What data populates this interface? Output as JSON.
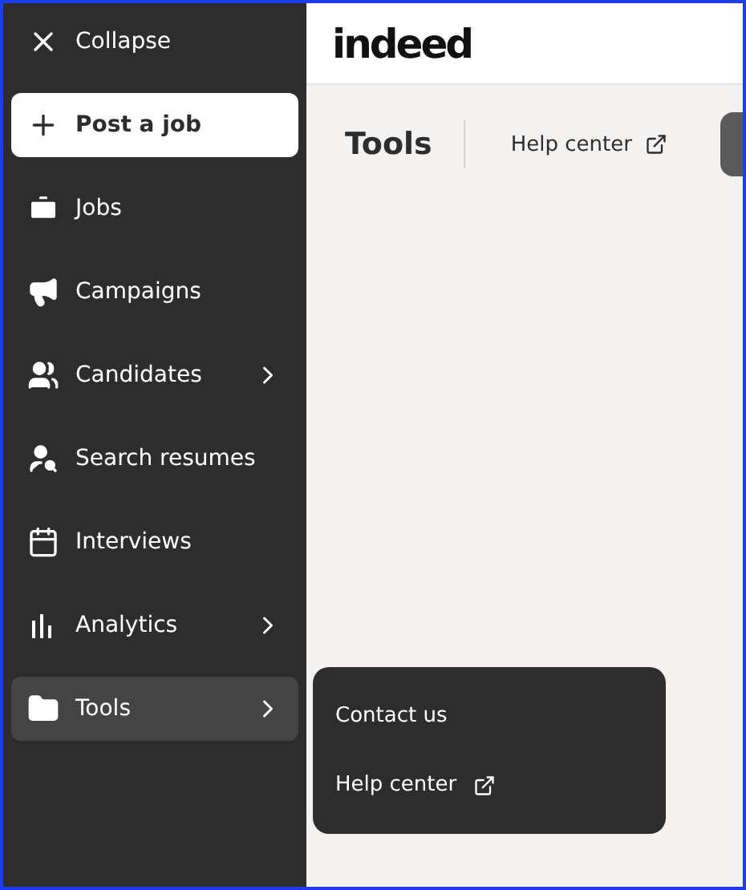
{
  "sidebar": {
    "collapse": {
      "label": "Collapse"
    },
    "post_job": {
      "label": "Post a job"
    },
    "items": [
      {
        "label": "Jobs",
        "has_submenu": false,
        "selected": false
      },
      {
        "label": "Campaigns",
        "has_submenu": false,
        "selected": false
      },
      {
        "label": "Candidates",
        "has_submenu": true,
        "selected": false
      },
      {
        "label": "Search resumes",
        "has_submenu": false,
        "selected": false
      },
      {
        "label": "Interviews",
        "has_submenu": false,
        "selected": false
      },
      {
        "label": "Analytics",
        "has_submenu": true,
        "selected": false
      },
      {
        "label": "Tools",
        "has_submenu": true,
        "selected": true
      }
    ]
  },
  "header": {
    "logo": "indeed"
  },
  "page": {
    "title": "Tools",
    "links": [
      {
        "label": "Help center",
        "external": true
      }
    ]
  },
  "flyout": {
    "items": [
      {
        "label": "Contact us",
        "external": false
      },
      {
        "label": "Help center",
        "external": true
      }
    ]
  }
}
